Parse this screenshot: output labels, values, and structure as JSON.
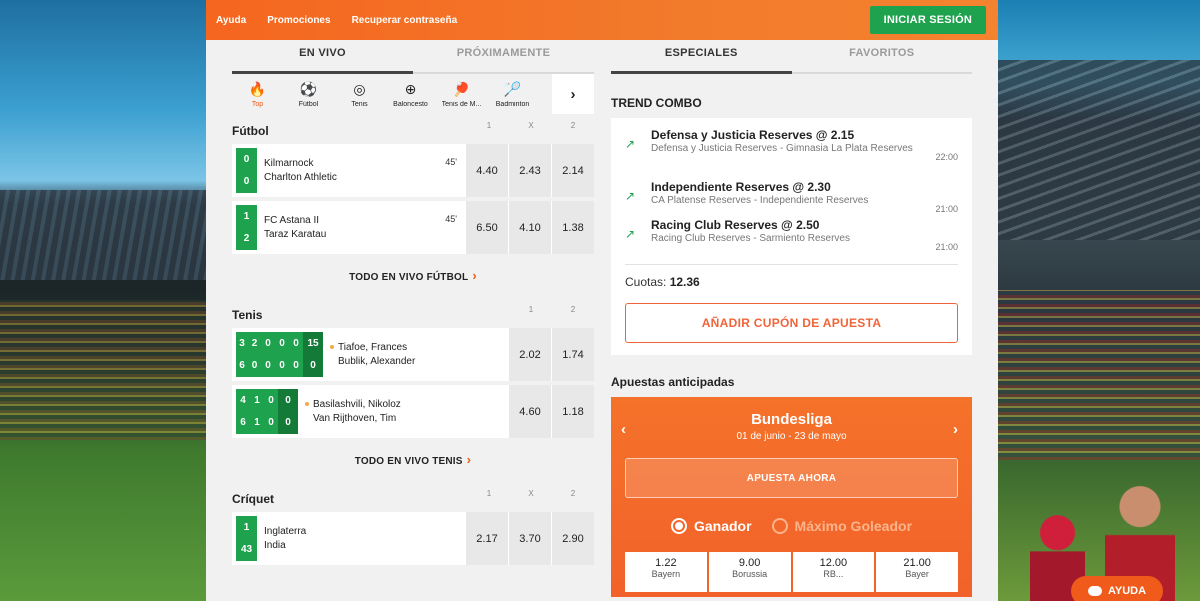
{
  "topbar": {
    "links": [
      "Ayuda",
      "Promociones",
      "Recuperar contraseña"
    ],
    "login_label": "INICIAR SESIÓN"
  },
  "left": {
    "tabs": [
      "EN VIVO",
      "PRÓXIMAMENTE"
    ],
    "sports": [
      {
        "label": "Top",
        "icon": "fire-icon"
      },
      {
        "label": "Fútbol",
        "icon": "soccer-ball-icon"
      },
      {
        "label": "Tenis",
        "icon": "tennis-ball-icon"
      },
      {
        "label": "Baloncesto",
        "icon": "basketball-icon"
      },
      {
        "label": "Tenis de M...",
        "icon": "table-tennis-icon"
      },
      {
        "label": "Badminton",
        "icon": "shuttlecock-icon"
      }
    ],
    "football": {
      "title": "Fútbol",
      "cols": [
        "1",
        "X",
        "2"
      ],
      "matches": [
        {
          "s1": "0",
          "s2": "0",
          "home": "Kilmarnock",
          "away": "Charlton Athletic",
          "minute": "45'",
          "o1": "4.40",
          "ox": "2.43",
          "o2": "2.14"
        },
        {
          "s1": "1",
          "s2": "2",
          "home": "FC Astana II",
          "away": "Taraz Karatau",
          "minute": "45'",
          "o1": "6.50",
          "ox": "4.10",
          "o2": "1.38"
        }
      ],
      "see_all": "TODO EN VIVO FÚTBOL"
    },
    "tennis": {
      "title": "Tenis",
      "cols": [
        "1",
        "2"
      ],
      "matches": [
        {
          "sets1": [
            "3",
            "2",
            "0",
            "0",
            "0",
            "15"
          ],
          "sets2": [
            "6",
            "0",
            "0",
            "0",
            "0",
            "0"
          ],
          "p1": "Tiafoe, Frances",
          "p2": "Bublik, Alexander",
          "o1": "2.02",
          "o2": "1.74"
        },
        {
          "sets1": [
            "4",
            "1",
            "0",
            "0"
          ],
          "sets2": [
            "6",
            "1",
            "0",
            "0"
          ],
          "p1": "Basilashvili, Nikoloz",
          "p2": "Van Rijthoven, Tim",
          "o1": "4.60",
          "o2": "1.18"
        }
      ],
      "see_all": "TODO EN VIVO TENIS"
    },
    "cricket": {
      "title": "Críquet",
      "cols": [
        "1",
        "X",
        "2"
      ],
      "match": {
        "s1": "1",
        "s2": "43",
        "home": "Inglaterra",
        "away": "India",
        "o1": "2.17",
        "ox": "3.70",
        "o2": "2.90"
      }
    }
  },
  "right": {
    "tabs": [
      "ESPECIALES",
      "FAVORITOS"
    ],
    "trend_title": "TREND COMBO",
    "combos": [
      {
        "title": "Defensa y Justicia Reserves @ 2.15",
        "sub": "Defensa y Justicia Reserves - Gimnasia La Plata Reserves",
        "time": "22:00"
      },
      {
        "title": "Independiente Reserves @ 2.30",
        "sub": "CA Platense Reserves - Independiente Reserves",
        "time": "21:00"
      },
      {
        "title": "Racing Club Reserves @ 2.50",
        "sub": "Racing Club Reserves - Sarmiento Reserves",
        "time": "21:00"
      }
    ],
    "cuotas_label": "Cuotas:",
    "cuotas_value": "12.36",
    "coupon_button": "AÑADIR CUPÓN DE APUESTA",
    "early_title": "Apuestas anticipadas",
    "promo": {
      "league": "Bundesliga",
      "dates": "01 de junio - 23 de mayo",
      "bet_now": "APUESTA AHORA",
      "radio_on": "Ganador",
      "radio_off": "Máximo Goleador",
      "odds": [
        {
          "value": "1.22",
          "name": "Bayern"
        },
        {
          "value": "9.00",
          "name": "Borussia"
        },
        {
          "value": "12.00",
          "name": "RB..."
        },
        {
          "value": "21.00",
          "name": "Bayer"
        }
      ]
    }
  },
  "help_label": "AYUDA",
  "colors": {
    "brand_orange": "#f5661f",
    "green": "#1ea24d"
  }
}
